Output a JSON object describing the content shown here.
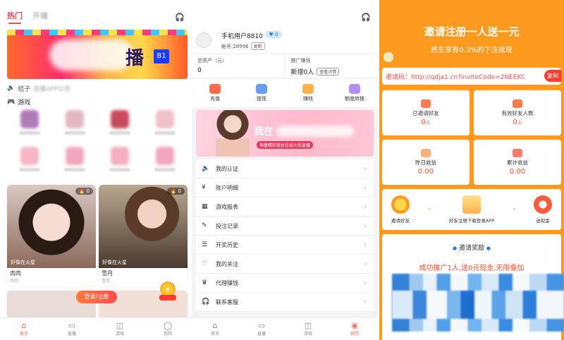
{
  "screen1": {
    "tabs": [
      "热门",
      "开播"
    ],
    "notice_label": "桔子",
    "notice_blur": "直播APP公告",
    "section_title": "游戏",
    "cards": [
      {
        "caption": "好像在火星",
        "name": "肉肉",
        "sub": "肉肉",
        "hot": "0"
      },
      {
        "caption": "好像在火星",
        "name": "雪月",
        "sub": "雪月",
        "hot": "0"
      }
    ],
    "login_label": "登录/注册",
    "tabbar": [
      "首页",
      "直播",
      "游戏",
      "我的"
    ]
  },
  "screen2": {
    "username": "手机用户8810",
    "vip": "0",
    "account_label": "帐号:28996",
    "copy_label": "复制",
    "total_assets_label": "总资产（元）",
    "total_assets_value": "0",
    "promo_label": "推广赚钱",
    "promo_value": "新增0人",
    "detail_label": "查看详情",
    "actions": [
      "充值",
      "提现",
      "赚钱",
      "额度转换"
    ],
    "banner_text": "我在",
    "banner_sub": "海量精彩美女在线火热直播",
    "menu": [
      "我的认证",
      "账户明细",
      "游戏报表",
      "投注记录",
      "开奖历史",
      "我的关注",
      "代理赚钱",
      "联系客服"
    ],
    "tabbar": [
      "首页",
      "直播",
      "游戏",
      "我的"
    ]
  },
  "screen3": {
    "title": "邀请注册一人送一元",
    "subtitle": "终生享有0.3%的下注返现",
    "invite_code": "邀请码：http://qdja1.cn?inviteCode=2NEEKC",
    "copy_label": "复制",
    "stats": [
      {
        "label": "已邀请好友",
        "value": "0",
        "unit": "人"
      },
      {
        "label": "有效好友人数",
        "value": "0",
        "unit": "人"
      },
      {
        "label": "昨日收益",
        "value": "0.00",
        "unit": ""
      },
      {
        "label": "累计收益",
        "value": "0.00",
        "unit": ""
      }
    ],
    "steps": [
      "邀请好友",
      "好友注册下载登录APP",
      "送现金"
    ],
    "reward_title": "邀请奖励",
    "reward_desc": "成功推广1人,送0元现金,无限叠加"
  },
  "colors": {
    "accent_red": "#e94b5c",
    "orange": "#ff9a1f",
    "reward_red": "#ff4d2d"
  }
}
